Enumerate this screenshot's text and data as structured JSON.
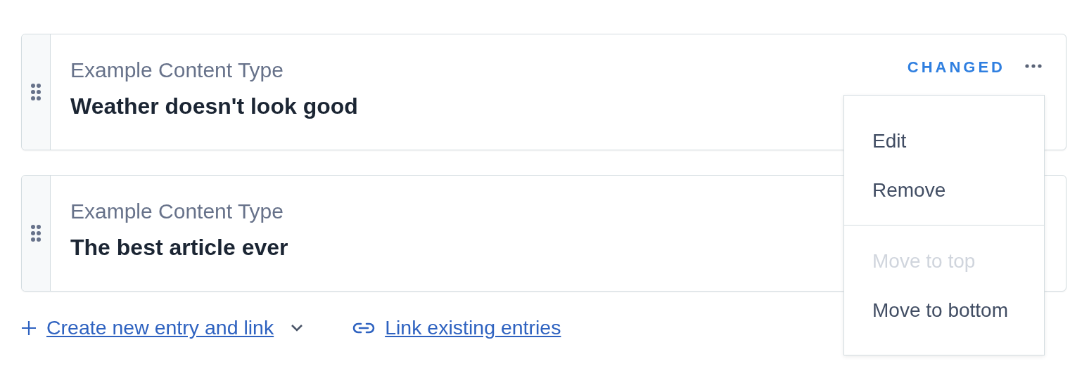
{
  "entries": [
    {
      "content_type": "Example Content Type",
      "title": "Weather doesn't look good",
      "status": "CHANGED",
      "menu_button": true
    },
    {
      "content_type": "Example Content Type",
      "title": "The best article ever"
    }
  ],
  "menu": {
    "groups": [
      [
        {
          "label": "Edit",
          "disabled": false
        },
        {
          "label": "Remove",
          "disabled": false
        }
      ],
      [
        {
          "label": "Move to top",
          "disabled": true
        },
        {
          "label": "Move to bottom",
          "disabled": false
        }
      ]
    ]
  },
  "actions": [
    {
      "kind": "create",
      "label": "Create new entry and link",
      "dropdown": true
    },
    {
      "kind": "link",
      "label": "Link existing entries"
    }
  ]
}
